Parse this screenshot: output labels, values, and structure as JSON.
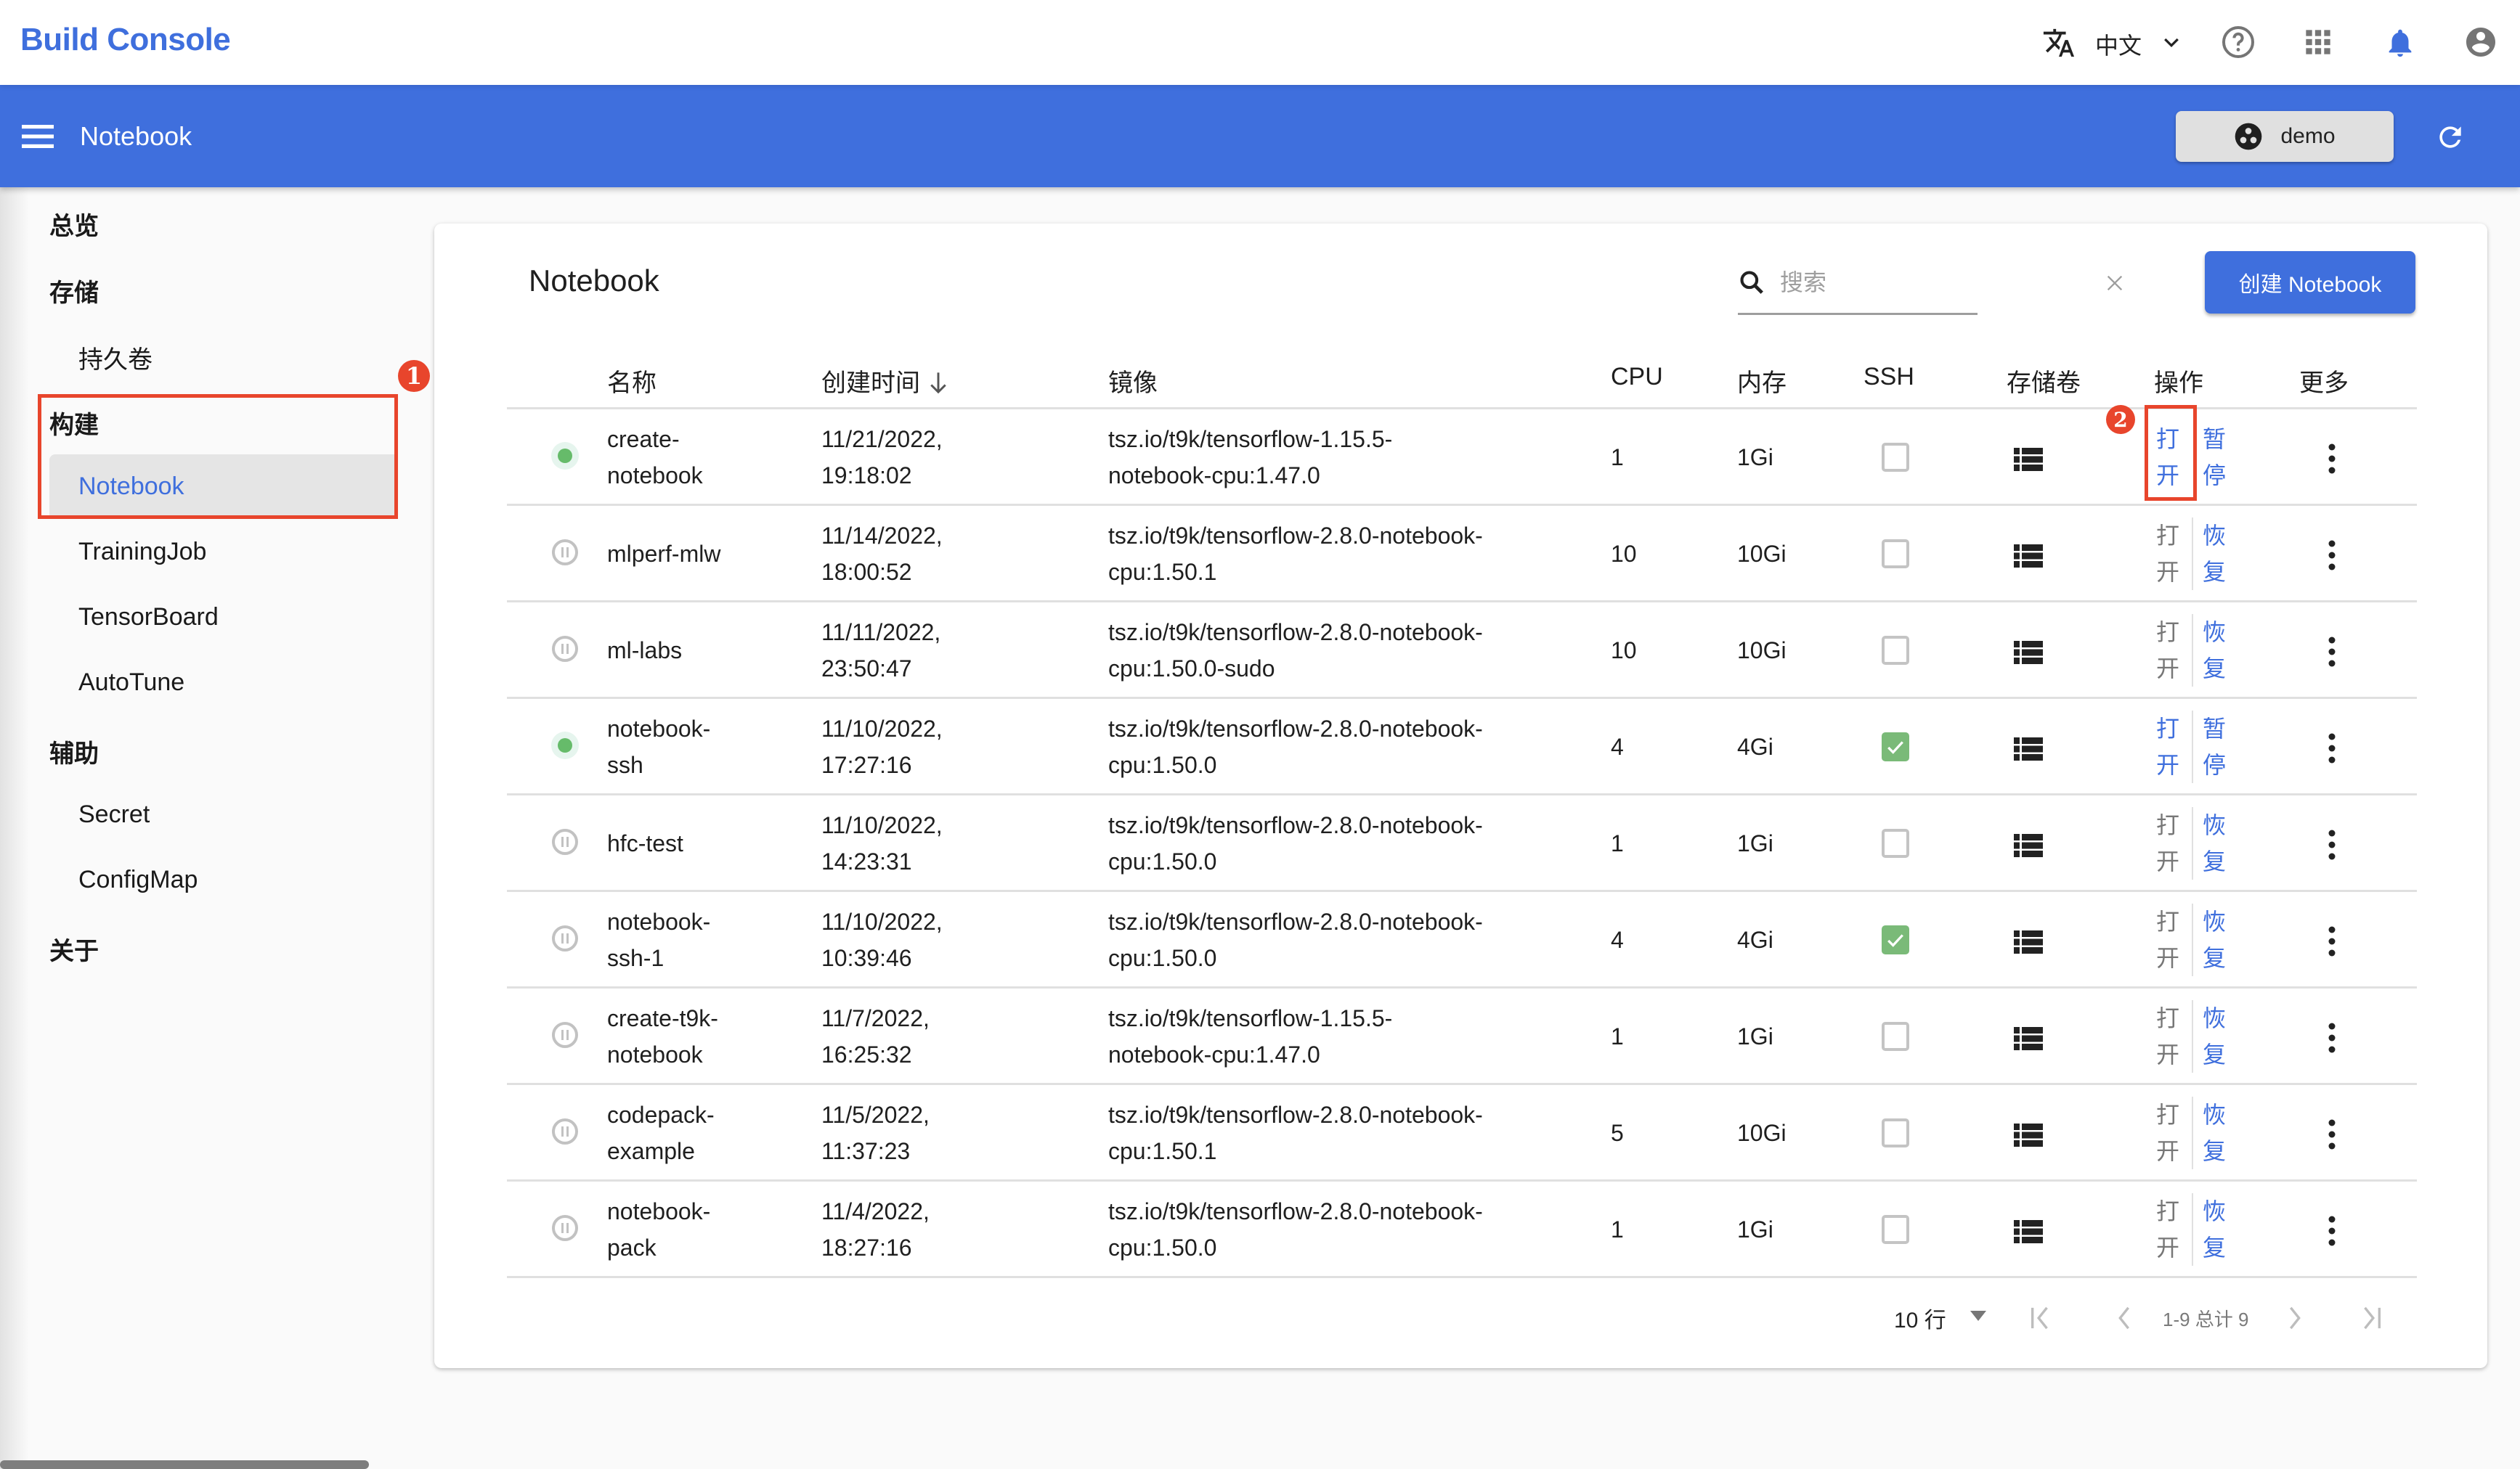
{
  "app": {
    "brand": "Build Console",
    "language_label": "中文"
  },
  "icons": {
    "language": "translate-icon",
    "language_menu": "chevron-down-icon",
    "help": "help-circle-icon",
    "apps": "apps-grid-icon",
    "notifications": "bell-icon",
    "account": "account-circle-icon",
    "menu": "hamburger-menu-icon",
    "namespace": "namespace-icon",
    "refresh": "refresh-icon",
    "search": "search-icon",
    "clear": "close-icon",
    "sort": "arrow-down-icon",
    "status_running": "status-running-dot-icon",
    "status_paused": "status-paused-icon",
    "volumes": "list-icon",
    "more": "more-vertical-icon"
  },
  "toolbar": {
    "title": "Notebook",
    "namespace": "demo"
  },
  "sidebar": {
    "items": [
      {
        "label": "总览",
        "level": "group"
      },
      {
        "label": "存储",
        "level": "group"
      },
      {
        "label": "持久卷",
        "level": "sub"
      },
      {
        "label": "构建",
        "level": "group"
      },
      {
        "label": "Notebook",
        "level": "sub",
        "active": true
      },
      {
        "label": "TrainingJob",
        "level": "sub"
      },
      {
        "label": "TensorBoard",
        "level": "sub"
      },
      {
        "label": "AutoTune",
        "level": "sub"
      },
      {
        "label": "辅助",
        "level": "group"
      },
      {
        "label": "Secret",
        "level": "sub"
      },
      {
        "label": "ConfigMap",
        "level": "sub"
      },
      {
        "label": "关于",
        "level": "group"
      }
    ]
  },
  "annotations": {
    "callout_1": "1",
    "callout_2": "2",
    "color": "#e8452c"
  },
  "card": {
    "title": "Notebook",
    "search_placeholder": "搜索",
    "search_value": "",
    "create_button": "创建 Notebook"
  },
  "table": {
    "columns": {
      "name": "名称",
      "created": "创建时间",
      "image": "镜像",
      "cpu": "CPU",
      "memory": "内存",
      "ssh": "SSH",
      "volumes": "存储卷",
      "actions": "操作",
      "more": "更多"
    },
    "sort": {
      "column": "created",
      "direction": "desc"
    },
    "rows": [
      {
        "status": "running",
        "name": "create-notebook",
        "name_lines": [
          "create-",
          "notebook"
        ],
        "created_lines": [
          "11/21/2022,",
          "19:18:02"
        ],
        "image_lines": [
          "tsz.io/t9k/tensorflow-1.15.5-",
          "notebook-cpu:1.47.0"
        ],
        "cpu": "1",
        "memory": "1Gi",
        "ssh": false,
        "open_label": [
          "打",
          "开"
        ],
        "open_enabled": true,
        "toggle_label": [
          "暂",
          "停"
        ]
      },
      {
        "status": "paused",
        "name": "mlperf-mlw",
        "name_lines": [
          "mlperf-mlw"
        ],
        "created_lines": [
          "11/14/2022,",
          "18:00:52"
        ],
        "image_lines": [
          "tsz.io/t9k/tensorflow-2.8.0-notebook-",
          "cpu:1.50.1"
        ],
        "cpu": "10",
        "memory": "10Gi",
        "ssh": false,
        "open_label": [
          "打",
          "开"
        ],
        "open_enabled": false,
        "toggle_label": [
          "恢",
          "复"
        ]
      },
      {
        "status": "paused",
        "name": "ml-labs",
        "name_lines": [
          "ml-labs"
        ],
        "created_lines": [
          "11/11/2022,",
          "23:50:47"
        ],
        "image_lines": [
          "tsz.io/t9k/tensorflow-2.8.0-notebook-",
          "cpu:1.50.0-sudo"
        ],
        "cpu": "10",
        "memory": "10Gi",
        "ssh": false,
        "open_label": [
          "打",
          "开"
        ],
        "open_enabled": false,
        "toggle_label": [
          "恢",
          "复"
        ]
      },
      {
        "status": "running",
        "name": "notebook-ssh",
        "name_lines": [
          "notebook-",
          "ssh"
        ],
        "created_lines": [
          "11/10/2022,",
          "17:27:16"
        ],
        "image_lines": [
          "tsz.io/t9k/tensorflow-2.8.0-notebook-",
          "cpu:1.50.0"
        ],
        "cpu": "4",
        "memory": "4Gi",
        "ssh": true,
        "open_label": [
          "打",
          "开"
        ],
        "open_enabled": true,
        "toggle_label": [
          "暂",
          "停"
        ]
      },
      {
        "status": "paused",
        "name": "hfc-test",
        "name_lines": [
          "hfc-test"
        ],
        "created_lines": [
          "11/10/2022,",
          "14:23:31"
        ],
        "image_lines": [
          "tsz.io/t9k/tensorflow-2.8.0-notebook-",
          "cpu:1.50.0"
        ],
        "cpu": "1",
        "memory": "1Gi",
        "ssh": false,
        "open_label": [
          "打",
          "开"
        ],
        "open_enabled": false,
        "toggle_label": [
          "恢",
          "复"
        ]
      },
      {
        "status": "paused",
        "name": "notebook-ssh-1",
        "name_lines": [
          "notebook-",
          "ssh-1"
        ],
        "created_lines": [
          "11/10/2022,",
          "10:39:46"
        ],
        "image_lines": [
          "tsz.io/t9k/tensorflow-2.8.0-notebook-",
          "cpu:1.50.0"
        ],
        "cpu": "4",
        "memory": "4Gi",
        "ssh": true,
        "open_label": [
          "打",
          "开"
        ],
        "open_enabled": false,
        "toggle_label": [
          "恢",
          "复"
        ]
      },
      {
        "status": "paused",
        "name": "create-t9k-notebook",
        "name_lines": [
          "create-t9k-",
          "notebook"
        ],
        "created_lines": [
          "11/7/2022,",
          "16:25:32"
        ],
        "image_lines": [
          "tsz.io/t9k/tensorflow-1.15.5-",
          "notebook-cpu:1.47.0"
        ],
        "cpu": "1",
        "memory": "1Gi",
        "ssh": false,
        "open_label": [
          "打",
          "开"
        ],
        "open_enabled": false,
        "toggle_label": [
          "恢",
          "复"
        ]
      },
      {
        "status": "paused",
        "name": "codepack-example",
        "name_lines": [
          "codepack-",
          "example"
        ],
        "created_lines": [
          "11/5/2022,",
          "11:37:23"
        ],
        "image_lines": [
          "tsz.io/t9k/tensorflow-2.8.0-notebook-",
          "cpu:1.50.1"
        ],
        "cpu": "5",
        "memory": "10Gi",
        "ssh": false,
        "open_label": [
          "打",
          "开"
        ],
        "open_enabled": false,
        "toggle_label": [
          "恢",
          "复"
        ]
      },
      {
        "status": "paused",
        "name": "notebook-pack",
        "name_lines": [
          "notebook-",
          "pack"
        ],
        "created_lines": [
          "11/4/2022,",
          "18:27:16"
        ],
        "image_lines": [
          "tsz.io/t9k/tensorflow-2.8.0-notebook-",
          "cpu:1.50.0"
        ],
        "cpu": "1",
        "memory": "1Gi",
        "ssh": false,
        "open_label": [
          "打",
          "开"
        ],
        "open_enabled": false,
        "toggle_label": [
          "恢",
          "复"
        ]
      }
    ]
  },
  "pagination": {
    "rows_per_page": "10 行",
    "range": "1-9 总计 9"
  },
  "colors": {
    "primary": "#3f6fdd",
    "running": "#66bb6a",
    "paused": "#bdbdbd",
    "ssh_checked": "#7aba78",
    "annotation": "#e8452c"
  }
}
